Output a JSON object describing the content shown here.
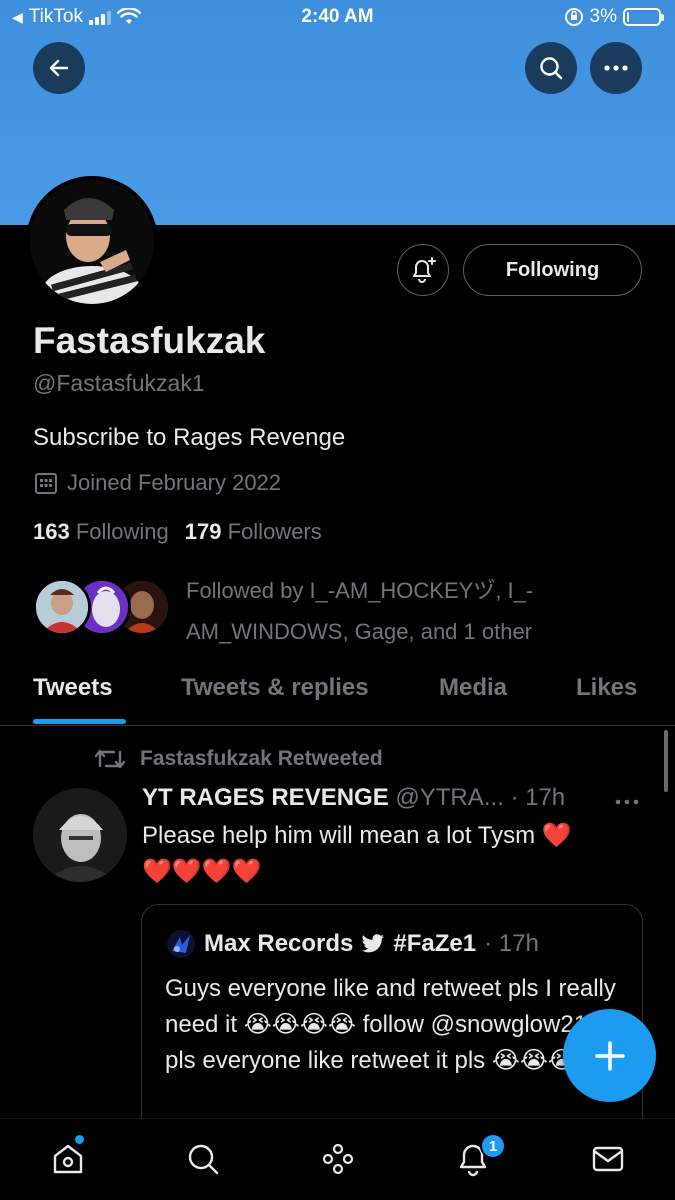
{
  "status_bar": {
    "back_app": "TikTok",
    "time": "2:40 AM",
    "battery": "3%",
    "battery_level": 0.03
  },
  "profile": {
    "display_name": "Fastasfukzak",
    "handle": "@Fastasfukzak1",
    "bio": "Subscribe to Rages Revenge",
    "joined": "Joined February 2022",
    "following_count": "163",
    "following_label": "Following",
    "followers_count": "179",
    "followers_label": "Followers",
    "followed_by": "Followed by I_-AM_HOCKEYヅ, I_-AM_WINDOWS, Gage, and 1 other",
    "follow_button": "Following"
  },
  "tabs": [
    {
      "label": "Tweets",
      "active": true
    },
    {
      "label": "Tweets & replies",
      "active": false
    },
    {
      "label": "Media",
      "active": false
    },
    {
      "label": "Likes",
      "active": false
    }
  ],
  "tweet": {
    "retweet_label": "Fastasfukzak Retweeted",
    "author_name": "YT RAGES REVENGE",
    "author_handle": "@YTRA...",
    "time": "· 17h",
    "text": "Please help him will mean a lot Tysm",
    "hearts_inline": "❤️",
    "hearts_line": "❤️❤️❤️❤️",
    "quote": {
      "author_name": "Max Records",
      "tag": "#FaZe1",
      "time": "· 17h",
      "text": "Guys everyone like and retweet pls I really need it 😭😭😭😭 follow @snowglow217 pls everyone like retweet it pls 😭😭😭"
    }
  },
  "nav": {
    "notification_count": "1"
  },
  "colors": {
    "accent": "#1d9bf0",
    "banner": "#4a9be6",
    "background": "#000000",
    "muted": "#71767b"
  },
  "icons": [
    "back-arrow-icon",
    "search-icon",
    "more-icon",
    "bell-plus-icon",
    "calendar-icon",
    "retweet-icon",
    "twitter-bird-icon",
    "compose-plus-icon",
    "home-icon",
    "explore-icon",
    "spaces-icon",
    "notifications-icon",
    "messages-icon"
  ]
}
